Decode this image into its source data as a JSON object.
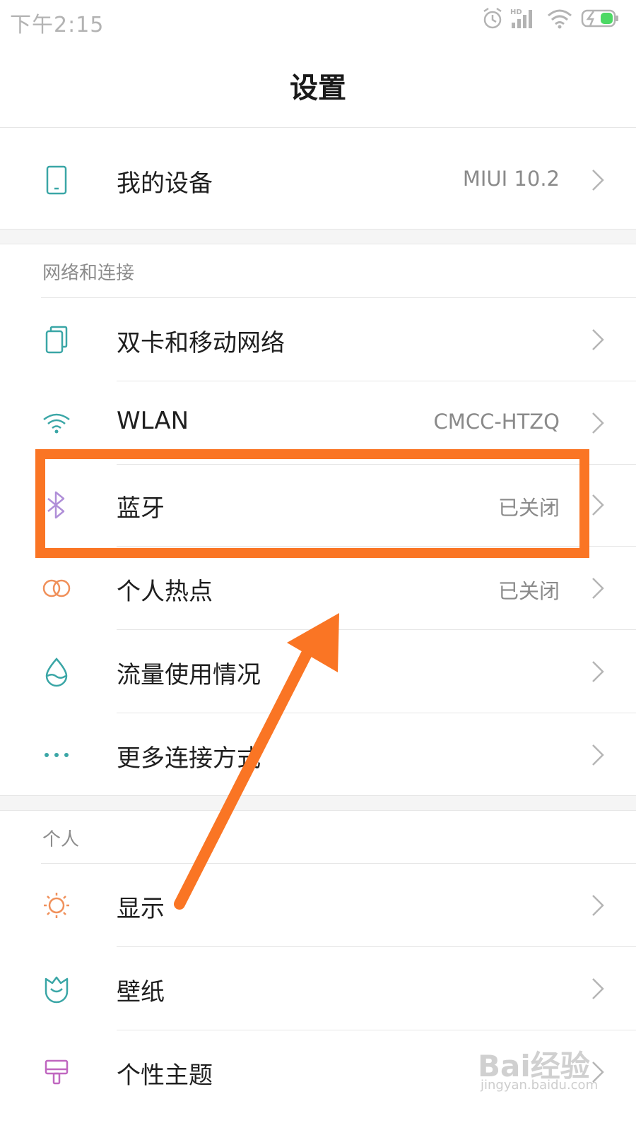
{
  "status_bar": {
    "time": "下午2:15",
    "icons": [
      "alarm-icon",
      "hd-signal-icon",
      "wifi-icon",
      "battery-icon"
    ]
  },
  "header": {
    "title": "设置"
  },
  "device_row": {
    "label": "我的设备",
    "value": "MIUI 10.2",
    "icon": "phone-icon"
  },
  "network": {
    "section_title": "网络和连接",
    "items": [
      {
        "label": "双卡和移动网络",
        "value": "",
        "icon": "dual-sim-icon"
      },
      {
        "label": "WLAN",
        "value": "CMCC-HTZQ",
        "icon": "wifi-icon"
      },
      {
        "label": "蓝牙",
        "value": "已关闭",
        "icon": "bluetooth-icon"
      },
      {
        "label": "个人热点",
        "value": "已关闭",
        "icon": "hotspot-icon"
      },
      {
        "label": "流量使用情况",
        "value": "",
        "icon": "data-usage-icon"
      },
      {
        "label": "更多连接方式",
        "value": "",
        "icon": "more-icon"
      }
    ]
  },
  "personal": {
    "section_title": "个人",
    "items": [
      {
        "label": "显示",
        "value": "",
        "icon": "display-icon"
      },
      {
        "label": "壁纸",
        "value": "",
        "icon": "wallpaper-icon"
      },
      {
        "label": "个性主题",
        "value": "",
        "icon": "theme-icon"
      }
    ]
  },
  "annotation": {
    "color": "#fa7524"
  },
  "watermark": {
    "main": "Bai经验",
    "sub": "jingyan.baidu.com"
  },
  "colors": {
    "icon_teal": "#3aa6a6",
    "icon_purple": "#b08fd8",
    "icon_orange": "#f0905a",
    "icon_pink": "#c067c0"
  }
}
